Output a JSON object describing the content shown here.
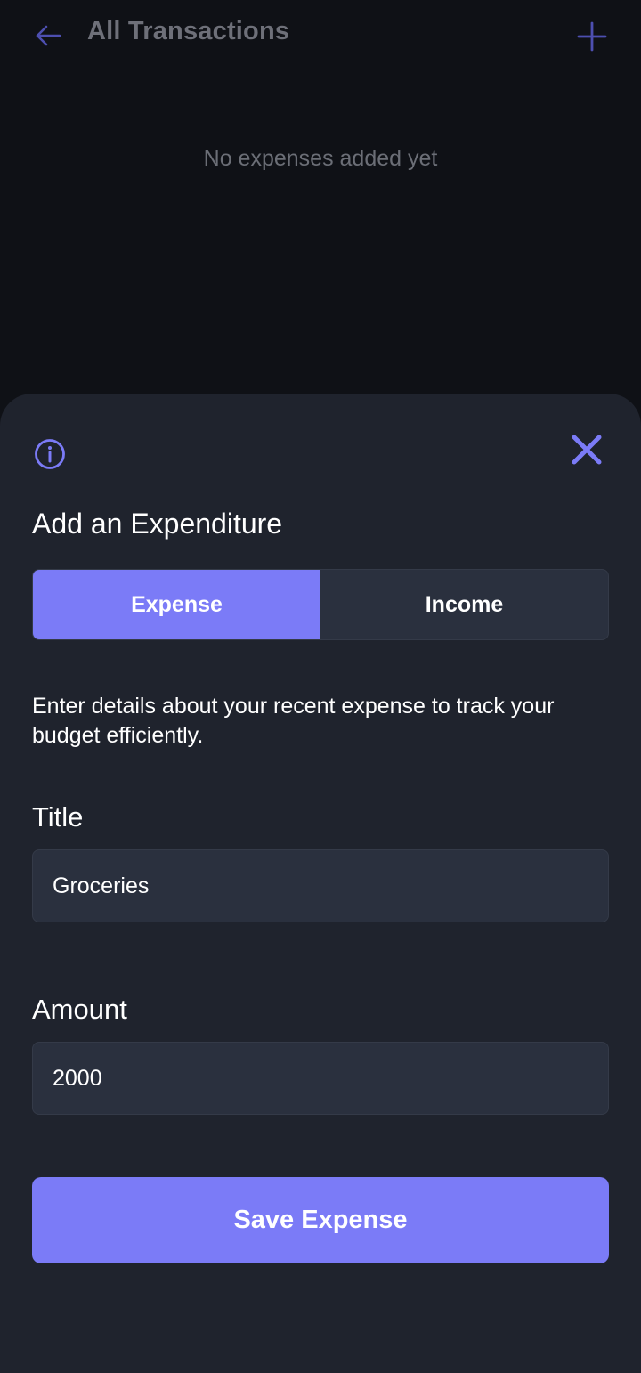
{
  "background_screen": {
    "title": "All Transactions",
    "back_icon": "arrow-left-icon",
    "add_icon": "plus-icon",
    "empty_message": "No expenses added yet"
  },
  "sheet": {
    "info_icon": "info-icon",
    "close_icon": "close-icon",
    "title": "Add an Expenditure",
    "tabs": [
      {
        "label": "Expense",
        "active": true
      },
      {
        "label": "Income",
        "active": false
      }
    ],
    "description": "Enter details about your recent expense to track your budget efficiently.",
    "fields": {
      "title": {
        "label": "Title",
        "value": "Groceries"
      },
      "amount": {
        "label": "Amount",
        "value": "2000"
      }
    },
    "save_label": "Save Expense"
  },
  "colors": {
    "background": "#0f1116",
    "sheet": "#1f232d",
    "accent": "#7b7bf7",
    "input_bg": "#2a303e",
    "muted_text": "#6b6e76"
  }
}
